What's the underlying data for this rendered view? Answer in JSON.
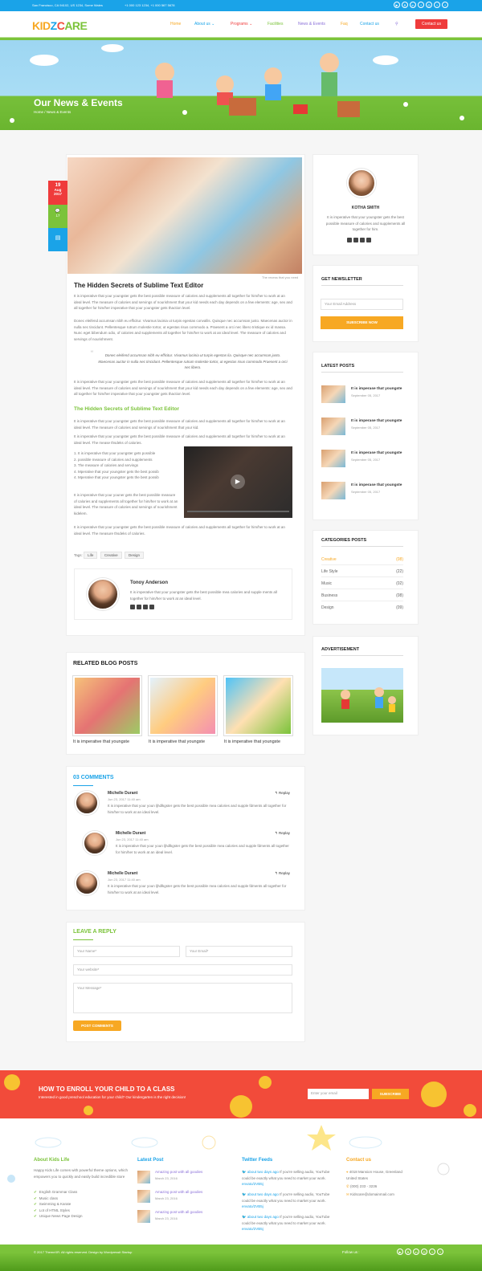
{
  "topbar": {
    "address": "San Francisco, CA 94102, US 1234, Some Wales",
    "phone": "+1 000 123 1234, +1 000 567 5678"
  },
  "header": {
    "logo": "KIDZCARE",
    "menu": [
      "Home",
      "About us",
      "Programs",
      "Facilities",
      "News & Events",
      "Faq",
      "Contact us"
    ],
    "cta": "Contact us"
  },
  "hero": {
    "title": "Our News & Events",
    "breadcrumb": "Home / News & Events"
  },
  "post": {
    "day": "19",
    "month": "Aug",
    "year": "2017",
    "comments": "17",
    "caption": "The recess that you need",
    "title": "The Hidden Secrets of Sublime Text Editor",
    "p1": "It is imperative that your youngster gets the best possible measure of calories and supplements all together for him/her to work at an ideal level. The measure of calories and servings of nourishment that your kid needs each day depends on a few elements: age, sex and all together for him/her imperative that your youngster gets thaction level.",
    "p2": "Donec eleifend accumsan nibh eu efficitur. Vivamus lacinia ut turpis egestas convallis. Quisque nec accumsan justo. Maecenas auctor in nulla nec tincidunt. Pellentesque rutrum molestie tortor, ut egestas risus commodo a. Praesent a orci nec libero tristique ex id massa. Nunc eget bibendum odio, of calories and supplements all together for him/her to work at an ideal level. The measure of calories and servings of nourishment.",
    "quote": "Donec eleifend accumsan nibh eu efficitur. Vivamus lacinia ut turpis egestas lia. Quisque nec accumsan justo. Maecenas auctor in nulla nec tincidunt. Pellentesque rutrum molestie tortor, ut egestas risus commodo Praesent a orci nec libero.",
    "p3": "It is imperative that your youngster gets the best possible measure of calories and supplements all together for him/her to work at an ideal level. The measure of calories and servings of nourishment that your kid needs each day depends on a few elements: age, sex and all together for him/her imperative that your youngster gets thaction level.",
    "subtitle": "The Hidden Secrets of Sublime Text Editor",
    "p4": "It is imperative that your youngster gets the best possible measure of calories and supplements all together for him/her to work at an ideal level. The measure of calories and servings of nourishment that your kid.",
    "p5": "It is imperative that your youngster gets the best possible measure of calories and supplements all together for him/her to work at an ideal level. The mease thsdeks of calories.",
    "list": [
      "1. It is imperative that your youngster gets  possible",
      "2. possible measure of calories and supplements",
      "3. The measure of calories and servings",
      "4. Mperative that your youngster gets the best possib",
      "4. Mperative that your youngster gets the best possib"
    ],
    "p6": "It is imperative that your youner gets the best possible measure of calories and supplements all together for him/her to work at an ideal level. The measure of calories and servings of nourishment kidelem.",
    "p7": "It is imperative that your youngster gets the best possible measure of calories and supplements all together for him/her to work at an ideal level. The measure thsdeks of calories.",
    "tags_label": "Tags:",
    "tags": [
      "Life",
      "Creative",
      "Design"
    ],
    "author_name": "Tonoy Anderson",
    "author_bio": "It is imperative that your youngster gets the best possible mea calories and supple ments all together for him/her to work at an ideal level."
  },
  "related": {
    "title": "RELATED BLOG POSTS",
    "items": [
      "It is imperative that youngste",
      "It is imperative that youngste",
      "It is imperative that youngste"
    ]
  },
  "comments": {
    "title": "03 COMMENTS",
    "reply": "Replay",
    "items": [
      {
        "name": "Michelle Durant",
        "date": "Jun 23, 2017 11:40 am",
        "text": "It is imperative that your youn ljhdlkgster gets the best possible mea calories and supple fdments all together for him/her to work at an ideal level."
      },
      {
        "name": "Michelle Durant",
        "date": "Jun 23, 2017 11:40 am",
        "text": "It is imperative that your youn ljhdlkgster gets the best possible mea calories and supple fdments all together for him/her to work at an ideal level."
      },
      {
        "name": "Michelle Durant",
        "date": "Jun 23, 2017 11:40 am",
        "text": "It is imperative that your youn ljhdlkgster gets the best possible mea calories and supple fdments all together for him/her to work at an ideal level."
      }
    ]
  },
  "reply_form": {
    "title": "LEAVE A REPLY",
    "name": "Your Name*",
    "email": "Your Email*",
    "website": "Your website*",
    "message": "Your Message*",
    "button": "POST COMMENTS"
  },
  "sidebar": {
    "profile": {
      "name": "KOTHA SMITH",
      "bio": "It is imperative that your youngster gets the best possible measure of calories and supplements all together for him."
    },
    "newsletter": {
      "title": "GET NEWSLETTER",
      "placeholder": "Your Email Address",
      "button": "SUBSCRIBE NOW"
    },
    "latest": {
      "title": "LATEST POSTS",
      "items": [
        {
          "title": "It is imperase that youngste",
          "date": "September 05, 2017"
        },
        {
          "title": "It is imperase that youngste",
          "date": "September 05, 2017"
        },
        {
          "title": "It is imperase that youngste",
          "date": "September 05, 2017"
        },
        {
          "title": "It is imperase that youngste",
          "date": "September 05, 2017"
        }
      ]
    },
    "categories": {
      "title": "CATEGORIES POSTS",
      "items": [
        {
          "name": "Creative",
          "count": "(08)"
        },
        {
          "name": "Life Style",
          "count": "(22)"
        },
        {
          "name": "Music",
          "count": "(02)"
        },
        {
          "name": "Business",
          "count": "(08)"
        },
        {
          "name": "Design",
          "count": "(09)"
        }
      ]
    },
    "ad": {
      "title": "ADVERTISEMENT"
    }
  },
  "enroll": {
    "title": "HOW TO ENROLL YOUR CHILD TO A CLASS",
    "sub": "Interested in good preschool education for your child? Our kindergarten is the right decision!",
    "placeholder": "Enter your email",
    "button": "SUBSCRIBE"
  },
  "footer": {
    "about": {
      "title": "About Kids Life",
      "text": "Happy Kids Life comes with powerful theme options, which empowers you to quickly and easily build incredible store",
      "items": [
        "English Grammar Class",
        "Music class",
        "Swimming & Karate",
        "Lot of HTML Styles",
        "Unique News Page Design"
      ]
    },
    "latest": {
      "title": "Latest Post",
      "items": [
        {
          "t": "Amazing post with all goodies",
          "d": "March 23, 2016"
        },
        {
          "t": "Amazing post with all goodies",
          "d": "March 23, 2016"
        },
        {
          "t": "Amazing post with all goodies",
          "d": "March 23, 2016"
        }
      ]
    },
    "twitter": {
      "title": "Twitter Feeds",
      "items": [
        {
          "time": "about two days ago",
          "text": "If you're selling audio, YouTube could be exactly what you need to market your work.",
          "link": "envato/2VB5j"
        },
        {
          "time": "about two days ago",
          "text": "If you're selling audio, YouTube could be exactly what you need to market your work.",
          "link": "envato/2VB5j"
        },
        {
          "time": "about two days ago",
          "text": "If you're selling audio, YouTube could be exactly what you need to market your work.",
          "link": "envato/2VB5j"
        }
      ]
    },
    "contact": {
      "title": "Contact us",
      "address": "4018 Mansion House, Greenland United States",
      "phone": "(000) 233 - 3236",
      "email": "Kidscare@domainmail.com"
    },
    "copyright": "© 2017 ThemeXR. All rights reserved. Design by Wordpressit Startup",
    "follow": "Follow us :"
  },
  "colors": {
    "blue": "#1aa3e8",
    "red": "#ef3b3b",
    "green": "#7bc33a",
    "orange": "#f7a823"
  }
}
